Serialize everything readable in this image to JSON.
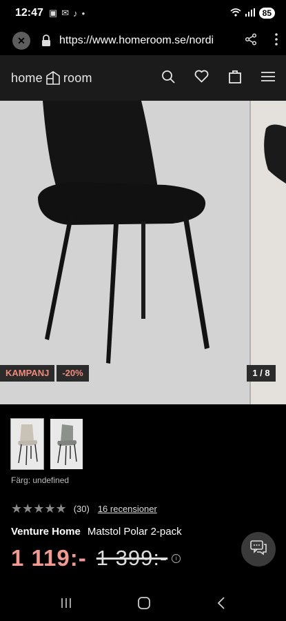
{
  "status_bar": {
    "time": "12:47",
    "battery": "85"
  },
  "browser": {
    "url": "https://www.homeroom.se/nordi"
  },
  "site": {
    "logo_left": "home",
    "logo_right": "room"
  },
  "gallery": {
    "badges": [
      "KAMPANJ",
      "-20%"
    ],
    "counter": "1 / 8"
  },
  "product": {
    "color_label": "Färg: undefined",
    "rating_value": 5,
    "rating_count": "(30)",
    "reviews_link": "16 recensioner",
    "brand": "Venture Home",
    "name": "Matstol Polar 2-pack",
    "price": "1 119:-",
    "old_price": "1 399:-"
  },
  "colors": {
    "accent_price": "#f19a92",
    "badge_text": "#f08a7a",
    "header_bg": "#1b1b1b"
  },
  "icons": [
    "close-icon",
    "lock-icon",
    "share-icon",
    "more-icon",
    "search-icon",
    "heart-icon",
    "bag-icon",
    "menu-icon",
    "chat-icon",
    "info-icon",
    "nav-recents-icon",
    "nav-home-icon",
    "nav-back-icon"
  ]
}
